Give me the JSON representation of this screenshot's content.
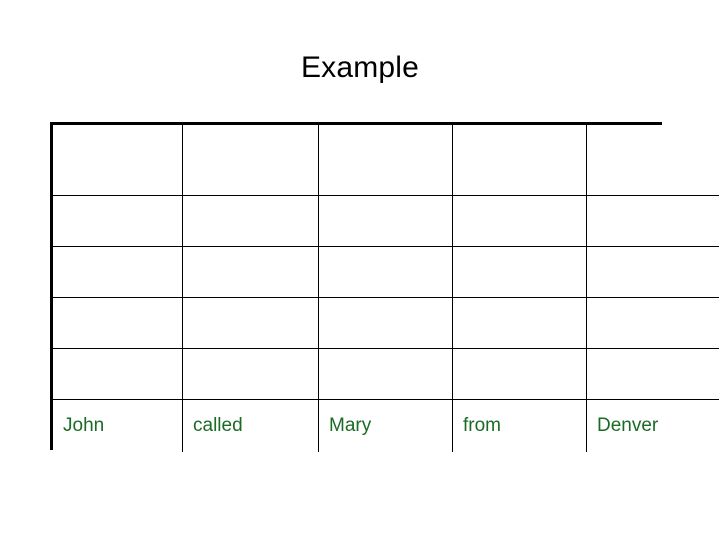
{
  "slide": {
    "title": "Example",
    "title_color": "#000000",
    "background_color": "#ffffff"
  },
  "table": {
    "columns": 5,
    "rows": 6,
    "border_color": "#000000",
    "cell_text_color": "#1a6b24",
    "outer_border_width_px": 3,
    "inner_border_width_px": 2,
    "grid": [
      [
        "",
        "",
        "",
        "",
        ""
      ],
      [
        "",
        "",
        "",
        "",
        ""
      ],
      [
        "",
        "",
        "",
        "",
        ""
      ],
      [
        "",
        "",
        "",
        "",
        ""
      ],
      [
        "",
        "",
        "",
        "",
        ""
      ],
      [
        "John",
        "called",
        "Mary",
        "from",
        "Denver"
      ]
    ],
    "sentence": [
      "John",
      "called",
      "Mary",
      "from",
      "Denver"
    ]
  }
}
